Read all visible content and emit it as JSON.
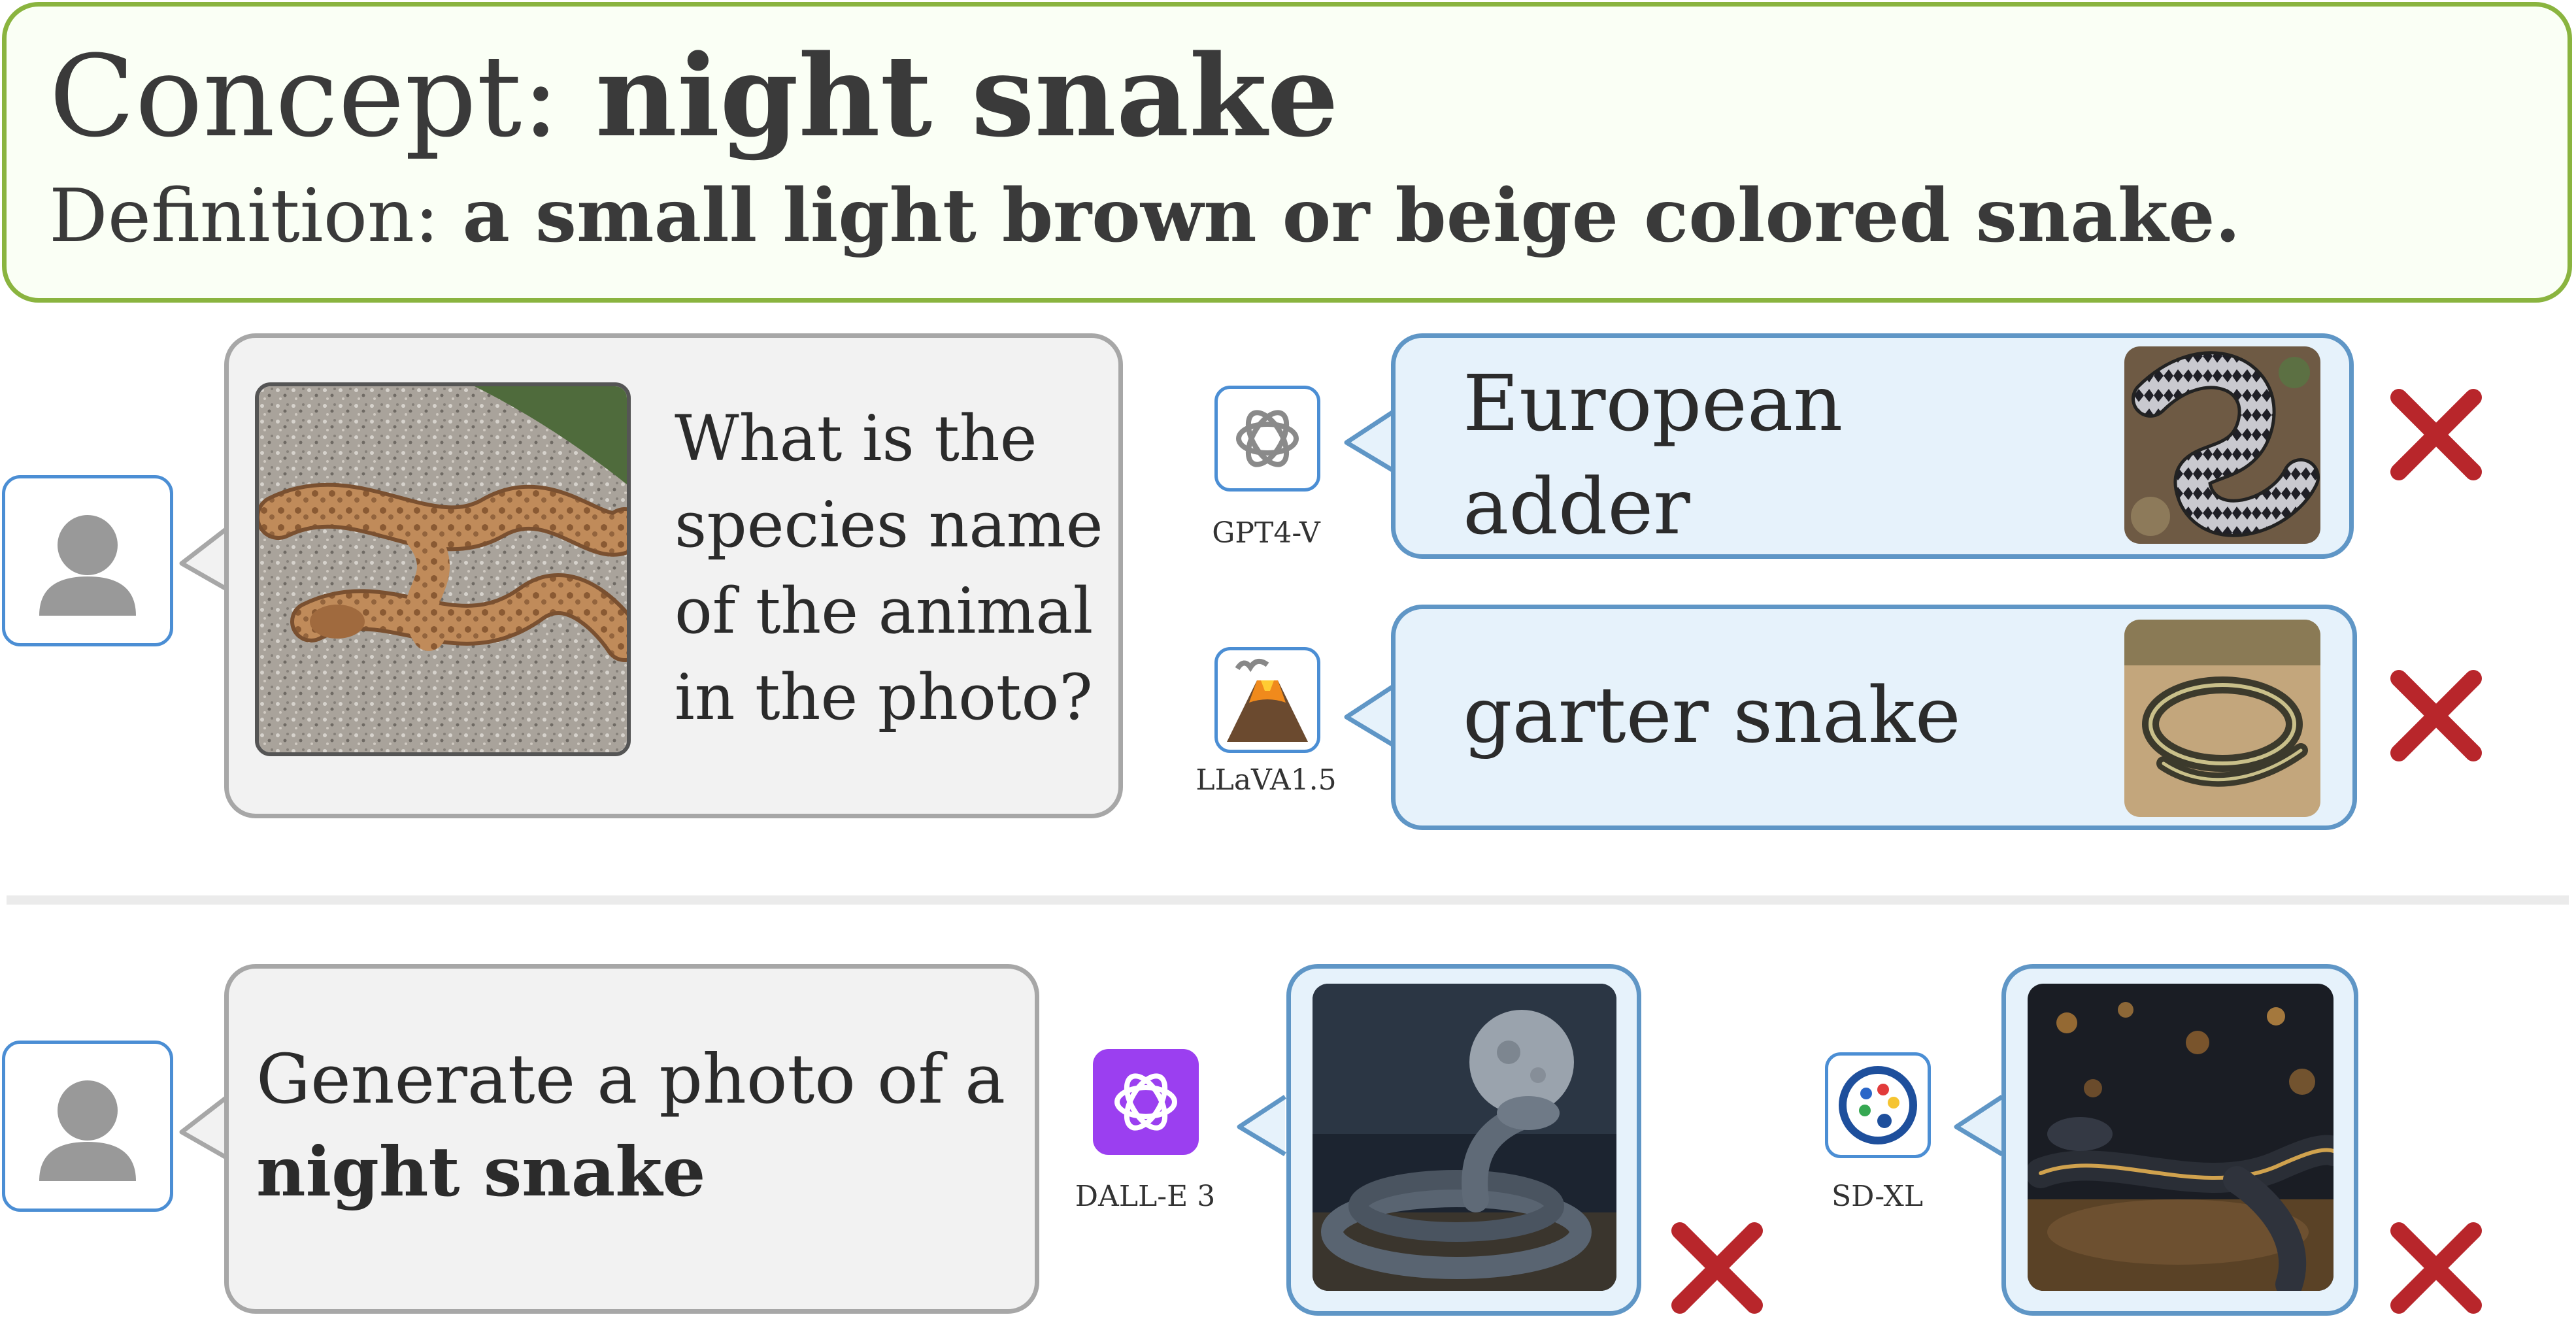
{
  "header": {
    "concept_label": "Concept:",
    "concept_value": "night snake",
    "definition_label": "Definition:",
    "definition_value": "a small light brown or beige colored snake."
  },
  "recognition": {
    "question_lines": [
      "What is the",
      "species name",
      "of the animal",
      "in the photo?"
    ],
    "answers": [
      {
        "model": "GPT4-V",
        "answer_lines": [
          "European",
          "adder"
        ],
        "correct": false
      },
      {
        "model": "LLaVA1.5",
        "answer_lines": [
          "garter snake"
        ],
        "correct": false
      }
    ]
  },
  "generation": {
    "prompt_line1": "Generate a photo of a",
    "prompt_line2": "night snake",
    "outputs": [
      {
        "model": "DALL-E 3",
        "correct": false
      },
      {
        "model": "SD-XL",
        "correct": false
      }
    ]
  },
  "icons": {
    "user": "user-avatar-icon",
    "gpt": "openai-logo-icon",
    "llava": "volcano-icon",
    "dalle": "openai-logo-icon",
    "sdxl": "palette-icon",
    "wrong": "red-x-icon"
  },
  "colors": {
    "header_border": "#8ab43f",
    "bubble_border_blue": "#5f96c6",
    "bubble_fill_blue": "#e6f2fb",
    "bubble_fill_gray": "#f2f2f2",
    "wrong_mark": "#b8262b",
    "dalle_purple": "#9b3ff0"
  }
}
